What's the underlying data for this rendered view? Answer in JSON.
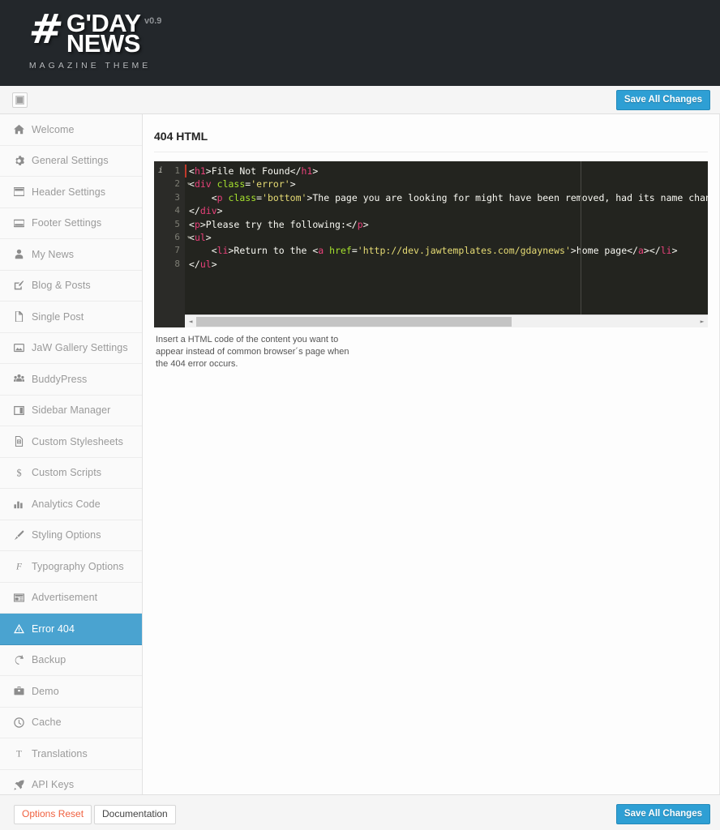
{
  "header": {
    "logo_hash": "#",
    "logo_line1": "G'DAY",
    "logo_line2": "NEWS",
    "logo_subtitle": "MAGAZINE THEME",
    "version": "v0.9",
    "bg_color": "#23272b"
  },
  "toolbar": {
    "collapse_tooltip": "Collapse menu",
    "save_label": "Save All Changes",
    "accent_color": "#2e9fd4"
  },
  "sidebar": {
    "items": [
      {
        "label": "Welcome",
        "icon": "home-icon",
        "active": false
      },
      {
        "label": "General Settings",
        "icon": "gear-icon",
        "active": false
      },
      {
        "label": "Header Settings",
        "icon": "window-header-icon",
        "active": false
      },
      {
        "label": "Footer Settings",
        "icon": "window-footer-icon",
        "active": false
      },
      {
        "label": "My News",
        "icon": "user-icon",
        "active": false
      },
      {
        "label": "Blog & Posts",
        "icon": "edit-square-icon",
        "active": false
      },
      {
        "label": "Single Post",
        "icon": "file-icon",
        "active": false
      },
      {
        "label": "JaW Gallery Settings",
        "icon": "image-icon",
        "active": false
      },
      {
        "label": "BuddyPress",
        "icon": "group-icon",
        "active": false
      },
      {
        "label": "Sidebar Manager",
        "icon": "columns-icon",
        "active": false
      },
      {
        "label": "Custom Stylesheets",
        "icon": "file-code-icon",
        "active": false
      },
      {
        "label": "Custom Scripts",
        "icon": "dollar-icon",
        "active": false
      },
      {
        "label": "Analytics Code",
        "icon": "bar-chart-icon",
        "active": false
      },
      {
        "label": "Styling Options",
        "icon": "brush-icon",
        "active": false
      },
      {
        "label": "Typography Options",
        "icon": "font-f-icon",
        "active": false
      },
      {
        "label": "Advertisement",
        "icon": "ad-layout-icon",
        "active": false
      },
      {
        "label": "Error 404",
        "icon": "warning-triangle-icon",
        "active": true
      },
      {
        "label": "Backup",
        "icon": "refresh-icon",
        "active": false
      },
      {
        "label": "Demo",
        "icon": "briefcase-icon",
        "active": false
      },
      {
        "label": "Cache",
        "icon": "clock-icon",
        "active": false
      },
      {
        "label": "Translations",
        "icon": "text-t-icon",
        "active": false
      },
      {
        "label": "API Keys",
        "icon": "rocket-icon",
        "active": false
      }
    ],
    "active_bg": "#4aa3d0"
  },
  "main": {
    "section_title": "404 HTML",
    "help_text": "Insert a HTML code of the content you want to appear instead of common browser´s page when the 404 error occurs."
  },
  "editor": {
    "background": "#23241f",
    "gutter_background": "#2b2b28",
    "annotation_marker": "i",
    "colors": {
      "tag": "#e8417a",
      "attribute": "#a6e22e",
      "string": "#e6db74",
      "text": "#f8f8f2"
    },
    "lines": [
      {
        "num": "1",
        "fold": false,
        "annotated": true,
        "tokens": [
          {
            "t": "txt",
            "v": "<"
          },
          {
            "t": "tag",
            "v": "h1"
          },
          {
            "t": "txt",
            "v": ">File Not Found</"
          },
          {
            "t": "tag",
            "v": "h1"
          },
          {
            "t": "txt",
            "v": ">"
          }
        ]
      },
      {
        "num": "2",
        "fold": true,
        "annotated": false,
        "tokens": [
          {
            "t": "txt",
            "v": "<"
          },
          {
            "t": "tag",
            "v": "div"
          },
          {
            "t": "txt",
            "v": " "
          },
          {
            "t": "attr",
            "v": "class"
          },
          {
            "t": "txt",
            "v": "="
          },
          {
            "t": "str",
            "v": "'error'"
          },
          {
            "t": "txt",
            "v": ">"
          }
        ]
      },
      {
        "num": "3",
        "fold": false,
        "annotated": false,
        "tokens": [
          {
            "t": "txt",
            "v": "    <"
          },
          {
            "t": "tag",
            "v": "p"
          },
          {
            "t": "txt",
            "v": " "
          },
          {
            "t": "attr",
            "v": "class"
          },
          {
            "t": "txt",
            "v": "="
          },
          {
            "t": "str",
            "v": "'bottom'"
          },
          {
            "t": "txt",
            "v": ">The page you are looking for might have been removed, had its name changed, or is t"
          }
        ]
      },
      {
        "num": "4",
        "fold": false,
        "annotated": false,
        "tokens": [
          {
            "t": "txt",
            "v": "</"
          },
          {
            "t": "tag",
            "v": "div"
          },
          {
            "t": "txt",
            "v": ">"
          }
        ]
      },
      {
        "num": "5",
        "fold": false,
        "annotated": false,
        "tokens": [
          {
            "t": "txt",
            "v": "<"
          },
          {
            "t": "tag",
            "v": "p"
          },
          {
            "t": "txt",
            "v": ">Please try the following:</"
          },
          {
            "t": "tag",
            "v": "p"
          },
          {
            "t": "txt",
            "v": ">"
          }
        ]
      },
      {
        "num": "6",
        "fold": true,
        "annotated": false,
        "tokens": [
          {
            "t": "txt",
            "v": "<"
          },
          {
            "t": "tag",
            "v": "ul"
          },
          {
            "t": "txt",
            "v": ">"
          }
        ]
      },
      {
        "num": "7",
        "fold": false,
        "annotated": false,
        "tokens": [
          {
            "t": "txt",
            "v": "    <"
          },
          {
            "t": "tag",
            "v": "li"
          },
          {
            "t": "txt",
            "v": ">Return to the <"
          },
          {
            "t": "tag",
            "v": "a"
          },
          {
            "t": "txt",
            "v": " "
          },
          {
            "t": "attr",
            "v": "href"
          },
          {
            "t": "txt",
            "v": "="
          },
          {
            "t": "str",
            "v": "'http://dev.jawtemplates.com/gdaynews'"
          },
          {
            "t": "txt",
            "v": ">home page</"
          },
          {
            "t": "tag",
            "v": "a"
          },
          {
            "t": "txt",
            "v": "></"
          },
          {
            "t": "tag",
            "v": "li"
          },
          {
            "t": "txt",
            "v": ">"
          }
        ]
      },
      {
        "num": "8",
        "fold": false,
        "annotated": false,
        "tokens": [
          {
            "t": "txt",
            "v": "</"
          },
          {
            "t": "tag",
            "v": "ul"
          },
          {
            "t": "txt",
            "v": ">"
          }
        ]
      }
    ],
    "scroll_left_arrow": "◄",
    "scroll_right_arrow": "►"
  },
  "footer": {
    "options_reset_label": "Options Reset",
    "documentation_label": "Documentation",
    "save_label": "Save All Changes",
    "reset_color": "#f0603f"
  }
}
